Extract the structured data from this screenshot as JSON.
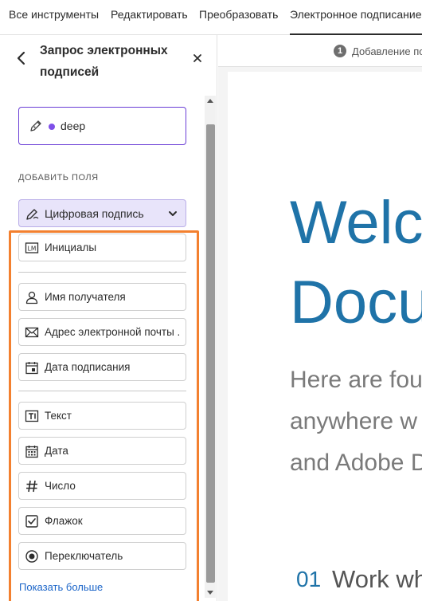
{
  "topnav": {
    "tabs": [
      {
        "label": "Все инструменты"
      },
      {
        "label": "Редактировать"
      },
      {
        "label": "Преобразовать"
      },
      {
        "label": "Электронное подписание"
      }
    ],
    "active_tab_index": 3
  },
  "panel": {
    "title": "Запрос электронных подписей",
    "recipient": {
      "name": "deep",
      "dot_color": "#7e4fe8"
    },
    "section_label": "ДОБАВИТЬ ПОЛЯ",
    "signature_dropdown": {
      "label": "Цифровая подпись"
    },
    "fields": [
      {
        "label": "Инициалы",
        "icon": "initials-icon"
      },
      {
        "label": "Имя получателя",
        "icon": "person-icon"
      },
      {
        "label": "Адрес электронной почты ...",
        "icon": "envelope-icon"
      },
      {
        "label": "Дата подписания",
        "icon": "calendar-signed-icon"
      },
      {
        "label": "Текст",
        "icon": "text-field-icon"
      },
      {
        "label": "Дата",
        "icon": "calendar-icon"
      },
      {
        "label": "Число",
        "icon": "number-icon"
      },
      {
        "label": "Флажок",
        "icon": "checkbox-icon"
      },
      {
        "label": "Переключатель",
        "icon": "radio-icon"
      }
    ],
    "show_more": "Показать больше"
  },
  "document": {
    "step_number": "1",
    "step_label": "Добавление по",
    "title_line1": "Welc",
    "title_line2": "Docu",
    "sub_line1": "Here are fou",
    "sub_line2": "anywhere w",
    "sub_line3": "and Adobe D",
    "section_num": "01",
    "section_text": "Work wh"
  },
  "colors": {
    "accent_purple": "#6b3fd6",
    "highlight_orange": "#f3802f",
    "link_blue": "#1a64c8",
    "doc_blue": "#1f73a8"
  }
}
